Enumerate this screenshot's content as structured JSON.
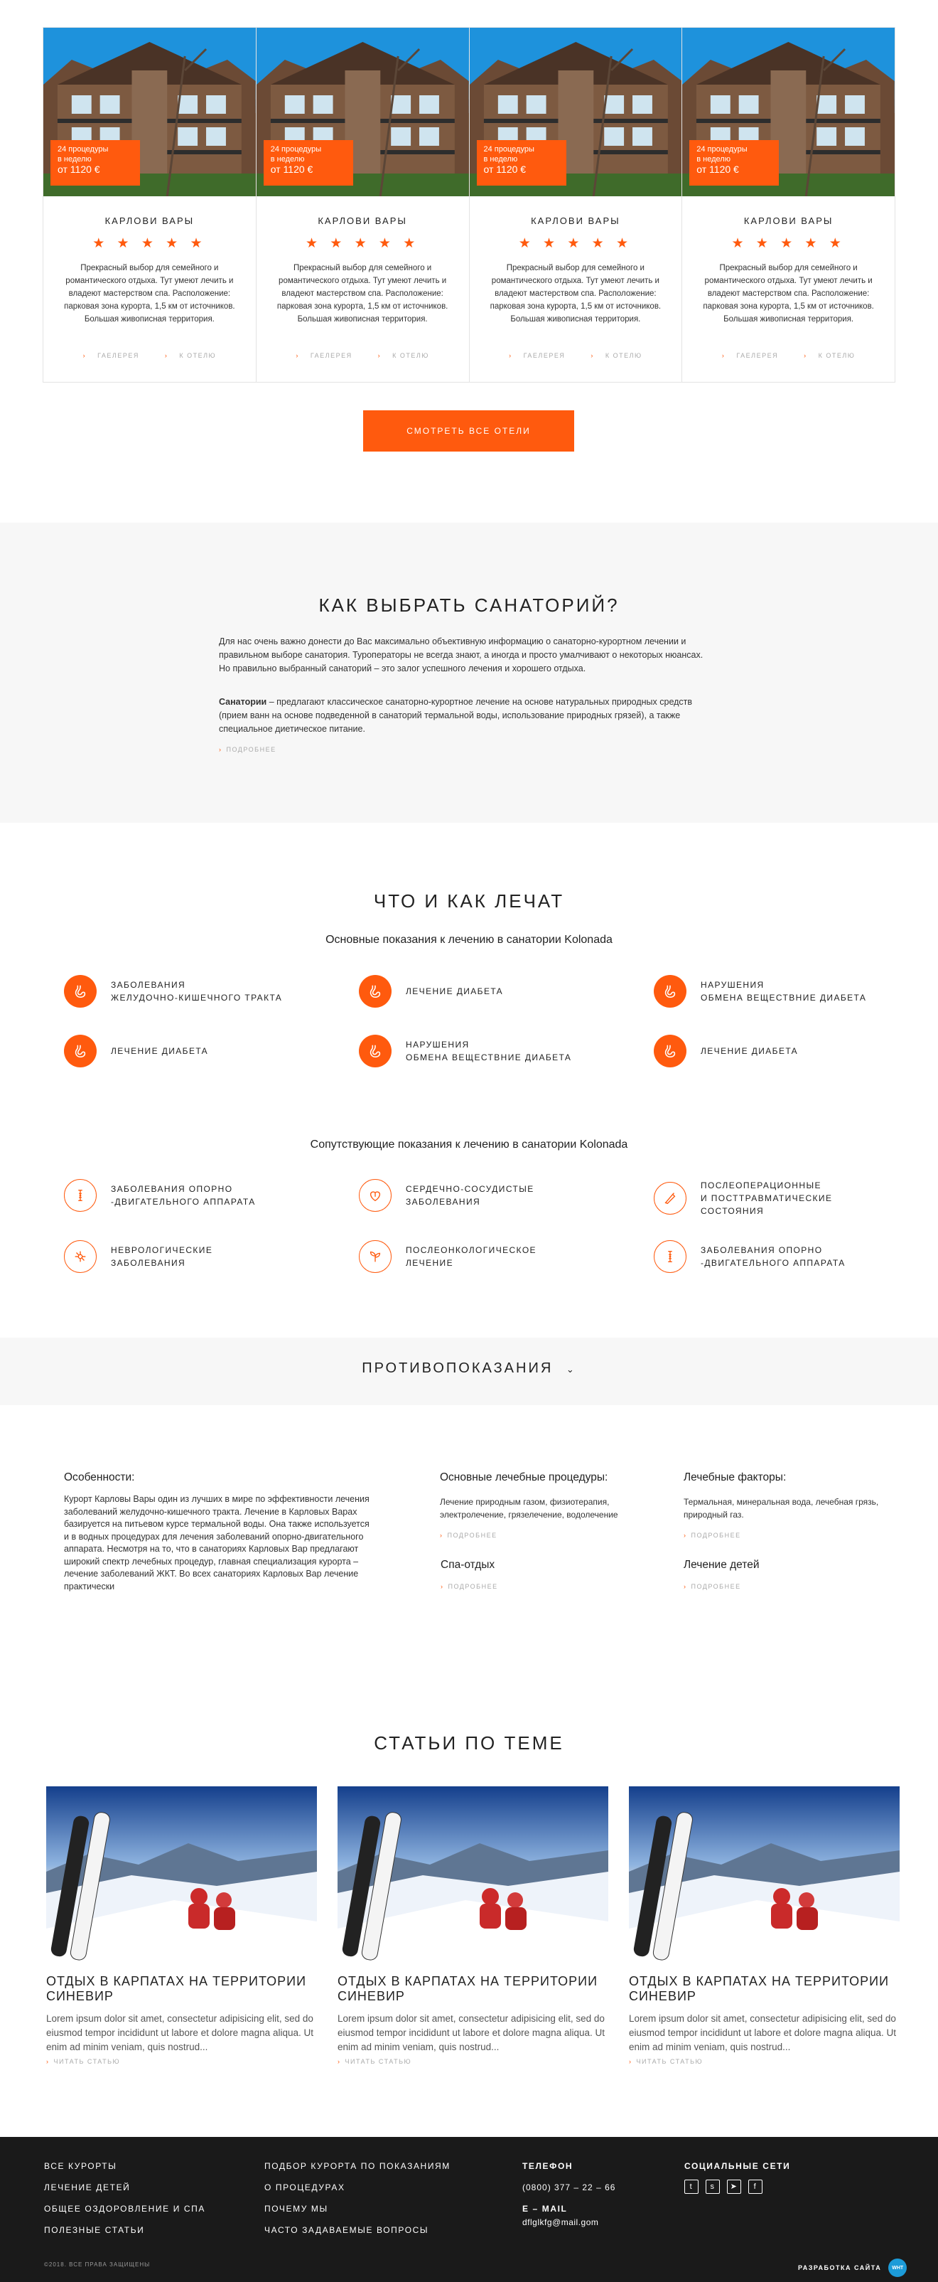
{
  "hotels": [
    {
      "badge_line1": "24 процедуры",
      "badge_line2": "в неделю",
      "badge_price": "от 1120 €",
      "title": "КАРЛОВИ ВАРЫ",
      "stars": "★ ★ ★ ★ ★",
      "desc": "Прекрасный выбор для семейного и романтического отдыха. Тут умеют лечить и владеют мастерством спа. Расположение: парковая зона курорта, 1,5 км от источников. Большая живописная территория.",
      "gallery": "ГАЕЛЕРЕЯ",
      "to_hotel": "К ОТЕЛЮ"
    },
    {
      "badge_line1": "24 процедуры",
      "badge_line2": "в неделю",
      "badge_price": "от 1120 €",
      "title": "КАРЛОВИ ВАРЫ",
      "stars": "★ ★ ★ ★ ★",
      "desc": "Прекрасный выбор для семейного и романтического отдыха. Тут умеют лечить и владеют мастерством спа. Расположение: парковая зона курорта, 1,5 км от источников. Большая живописная территория.",
      "gallery": "ГАЕЛЕРЕЯ",
      "to_hotel": "К ОТЕЛЮ"
    },
    {
      "badge_line1": "24 процедуры",
      "badge_line2": "в неделю",
      "badge_price": "от 1120 €",
      "title": "КАРЛОВИ ВАРЫ",
      "stars": "★ ★ ★ ★ ★",
      "desc": "Прекрасный выбор для семейного и романтического отдыха. Тут умеют лечить и владеют мастерством спа. Расположение: парковая зона курорта, 1,5 км от источников. Большая живописная территория.",
      "gallery": "ГАЕЛЕРЕЯ",
      "to_hotel": "К ОТЕЛЮ"
    },
    {
      "badge_line1": "24 процедуры",
      "badge_line2": "в неделю",
      "badge_price": "от 1120 €",
      "title": "КАРЛОВИ ВАРЫ",
      "stars": "★ ★ ★ ★ ★",
      "desc": "Прекрасный выбор для семейного и романтического отдыха. Тут умеют лечить и владеют мастерством спа. Расположение: парковая зона курорта, 1,5 км от источников. Большая живописная территория.",
      "gallery": "ГАЕЛЕРЕЯ",
      "to_hotel": "К ОТЕЛЮ"
    }
  ],
  "all_hotels_button": "СМОТРЕТЬ ВСЕ ОТЕЛИ",
  "choose": {
    "title": "КАК ВЫБРАТЬ САНАТОРИЙ?",
    "p1": "Для нас очень важно донести до Вас максимально объективную информацию о санаторно-курортном лечении и правильном выборе санатория. Туроператоры не всегда знают, а иногда и просто умалчивают о некоторых нюансах. Но правильно выбранный санаторий – это залог успешного лечения и хорошего отдыха.",
    "p2_bold": "Санатории",
    "p2_rest": " – предлагают классическое санаторно-курортное лечение на основе натуральных природных средств (прием ванн на основе подведенной в санаторий термальной воды, использование природных грязей), а также специальное диетическое питание.",
    "more": "ПОДРОБНЕЕ"
  },
  "treat": {
    "title": "ЧТО И КАК ЛЕЧАТ",
    "main_subtitle": "Основные показания к лечению в санатории Kolonada",
    "main_items": [
      {
        "l1": "ЗАБОЛЕВАНИЯ",
        "l2": "ЖЕЛУДОЧНО-КИШЕЧНОГО ТРАКТА",
        "icon": "stomach-icon"
      },
      {
        "l1": "ЛЕЧЕНИЕ ДИАБЕТА",
        "l2": "",
        "icon": "stomach-icon"
      },
      {
        "l1": "НАРУШЕНИЯ",
        "l2": "ОБМЕНА ВЕЩЕСТВНИЕ ДИАБЕТА",
        "icon": "stomach-icon"
      },
      {
        "l1": "ЛЕЧЕНИЕ ДИАБЕТА",
        "l2": "",
        "icon": "stomach-icon"
      },
      {
        "l1": "НАРУШЕНИЯ",
        "l2": "ОБМЕНА ВЕЩЕСТВНИЕ ДИАБЕТА",
        "icon": "stomach-icon"
      },
      {
        "l1": "ЛЕЧЕНИЕ ДИАБЕТА",
        "l2": "",
        "icon": "stomach-icon"
      }
    ],
    "extra_subtitle": "Сопутствующие показания к лечению в санатории Kolonada",
    "extra_items": [
      {
        "l1": "ЗАБОЛЕВАНИЯ ОПОРНО",
        "l2": "-ДВИГАТЕЛЬНОГО АППАРАТА",
        "l3": "",
        "icon": "bone-icon"
      },
      {
        "l1": "СЕРДЕЧНО-СОСУДИСТЫЕ",
        "l2": "ЗАБОЛЕВАНИЯ",
        "l3": "",
        "icon": "heart-icon"
      },
      {
        "l1": "ПОСЛЕОПЕРАЦИОННЫЕ",
        "l2": "И ПОСТТРАВМАТИЧЕСКИЕ",
        "l3": "СОСТОЯНИЯ",
        "icon": "scalpel-icon"
      },
      {
        "l1": "НЕВРОЛОГИЧЕСКИЕ",
        "l2": "ЗАБОЛЕВАНИЯ",
        "l3": "",
        "icon": "neuron-icon"
      },
      {
        "l1": "ПОСЛЕОНКОЛОГИЧЕСКОЕ",
        "l2": "ЛЕЧЕНИЕ",
        "l3": "",
        "icon": "sprout-icon"
      },
      {
        "l1": "ЗАБОЛЕВАНИЯ ОПОРНО",
        "l2": "-ДВИГАТЕЛЬНОГО АППАРАТА",
        "l3": "",
        "icon": "bone-icon"
      }
    ]
  },
  "contra": {
    "title": "ПРОТИВОПОКАЗАНИЯ"
  },
  "features": {
    "h1": "Особенности:",
    "t1": "Курорт Карловы Вары один из лучших в мире по эффективности лечения заболеваний желудочно-кишечного тракта. Лечение в Карловых Варах базируется на питьевом курсе термальной воды. Она также используется и в водных процедурах для лечения заболеваний опорно-двигательного аппарата. Несмотря на то, что в санаториях Карловых Вар предлагают широкий спектр лечебных процедур, главная специализация курорта – лечение заболеваний ЖКТ. Во всех санаториях Карловых Вар лечение практически",
    "h2": "Основные лечебные процедуры:",
    "t2": "Лечение природным газом, физиотерапия, электролечение, грязелечение, водолечение",
    "h3": "Лечебные факторы:",
    "t3": "Термальная, минеральная вода, лечебная грязь, природный газ.",
    "h4": "Спа-отдых",
    "h5": "Лечение детей",
    "more": "ПОДРОБНЕЕ"
  },
  "articles": {
    "title": "СТАТЬИ ПО ТЕМЕ",
    "items": [
      {
        "title": "ОТДЫХ В КАРПАТАХ НА ТЕРРИТОРИИ СИНЕВИР",
        "text": "Lorem ipsum dolor sit amet, consectetur adipisicing elit, sed do eiusmod tempor incididunt ut labore et dolore magna aliqua. Ut enim ad minim veniam, quis nostrud...",
        "link": "ЧИТАТЬ СТАТЬЮ"
      },
      {
        "title": "ОТДЫХ В КАРПАТАХ НА ТЕРРИТОРИИ СИНЕВИР",
        "text": "Lorem ipsum dolor sit amet, consectetur adipisicing elit, sed do eiusmod tempor incididunt ut labore et dolore magna aliqua. Ut enim ad minim veniam, quis nostrud...",
        "link": "ЧИТАТЬ СТАТЬЮ"
      },
      {
        "title": "ОТДЫХ В КАРПАТАХ НА ТЕРРИТОРИИ СИНЕВИР",
        "text": "Lorem ipsum dolor sit amet, consectetur adipisicing elit, sed do eiusmod tempor incididunt ut labore et dolore magna aliqua. Ut enim ad minim veniam, quis nostrud...",
        "link": "ЧИТАТЬ СТАТЬЮ"
      }
    ]
  },
  "footer": {
    "col1": [
      "ВСЕ КУРОРТЫ",
      "ЛЕЧЕНИЕ ДЕТЕЙ",
      "ОБЩЕЕ ОЗДОРОВЛЕНИЕ И СПА",
      "ПОЛЕЗНЫЕ СТАТЬИ"
    ],
    "col2": [
      "ПОДБОР КУРОРТА ПО ПОКАЗАНИЯМ",
      "О ПРОЦЕДУРАХ",
      "ПОЧЕМУ МЫ",
      "ЧАСТО ЗАДАВАЕМЫЕ ВОПРОСЫ"
    ],
    "phone_label": "ТЕЛЕФОН",
    "phone": "(0800) 377 – 22 – 66",
    "email_label": "E – MAIL",
    "email": "dflglkfg@mail.gom",
    "social_label": "СОЦИАЛЬНЫЕ СЕТИ",
    "social_icons": [
      "twitter-icon",
      "skype-icon",
      "telegram-icon",
      "facebook-icon"
    ],
    "copyright": "©2018. ВСЕ ПРАВА ЗАЩИЩЕНЫ",
    "dev_label": "РАЗРАБОТКА САЙТА",
    "dev_logo": "WHT"
  },
  "colors": {
    "accent": "#ff5a0e",
    "footer_bg": "#1a1a1a",
    "section_grey": "#f7f7f7"
  }
}
